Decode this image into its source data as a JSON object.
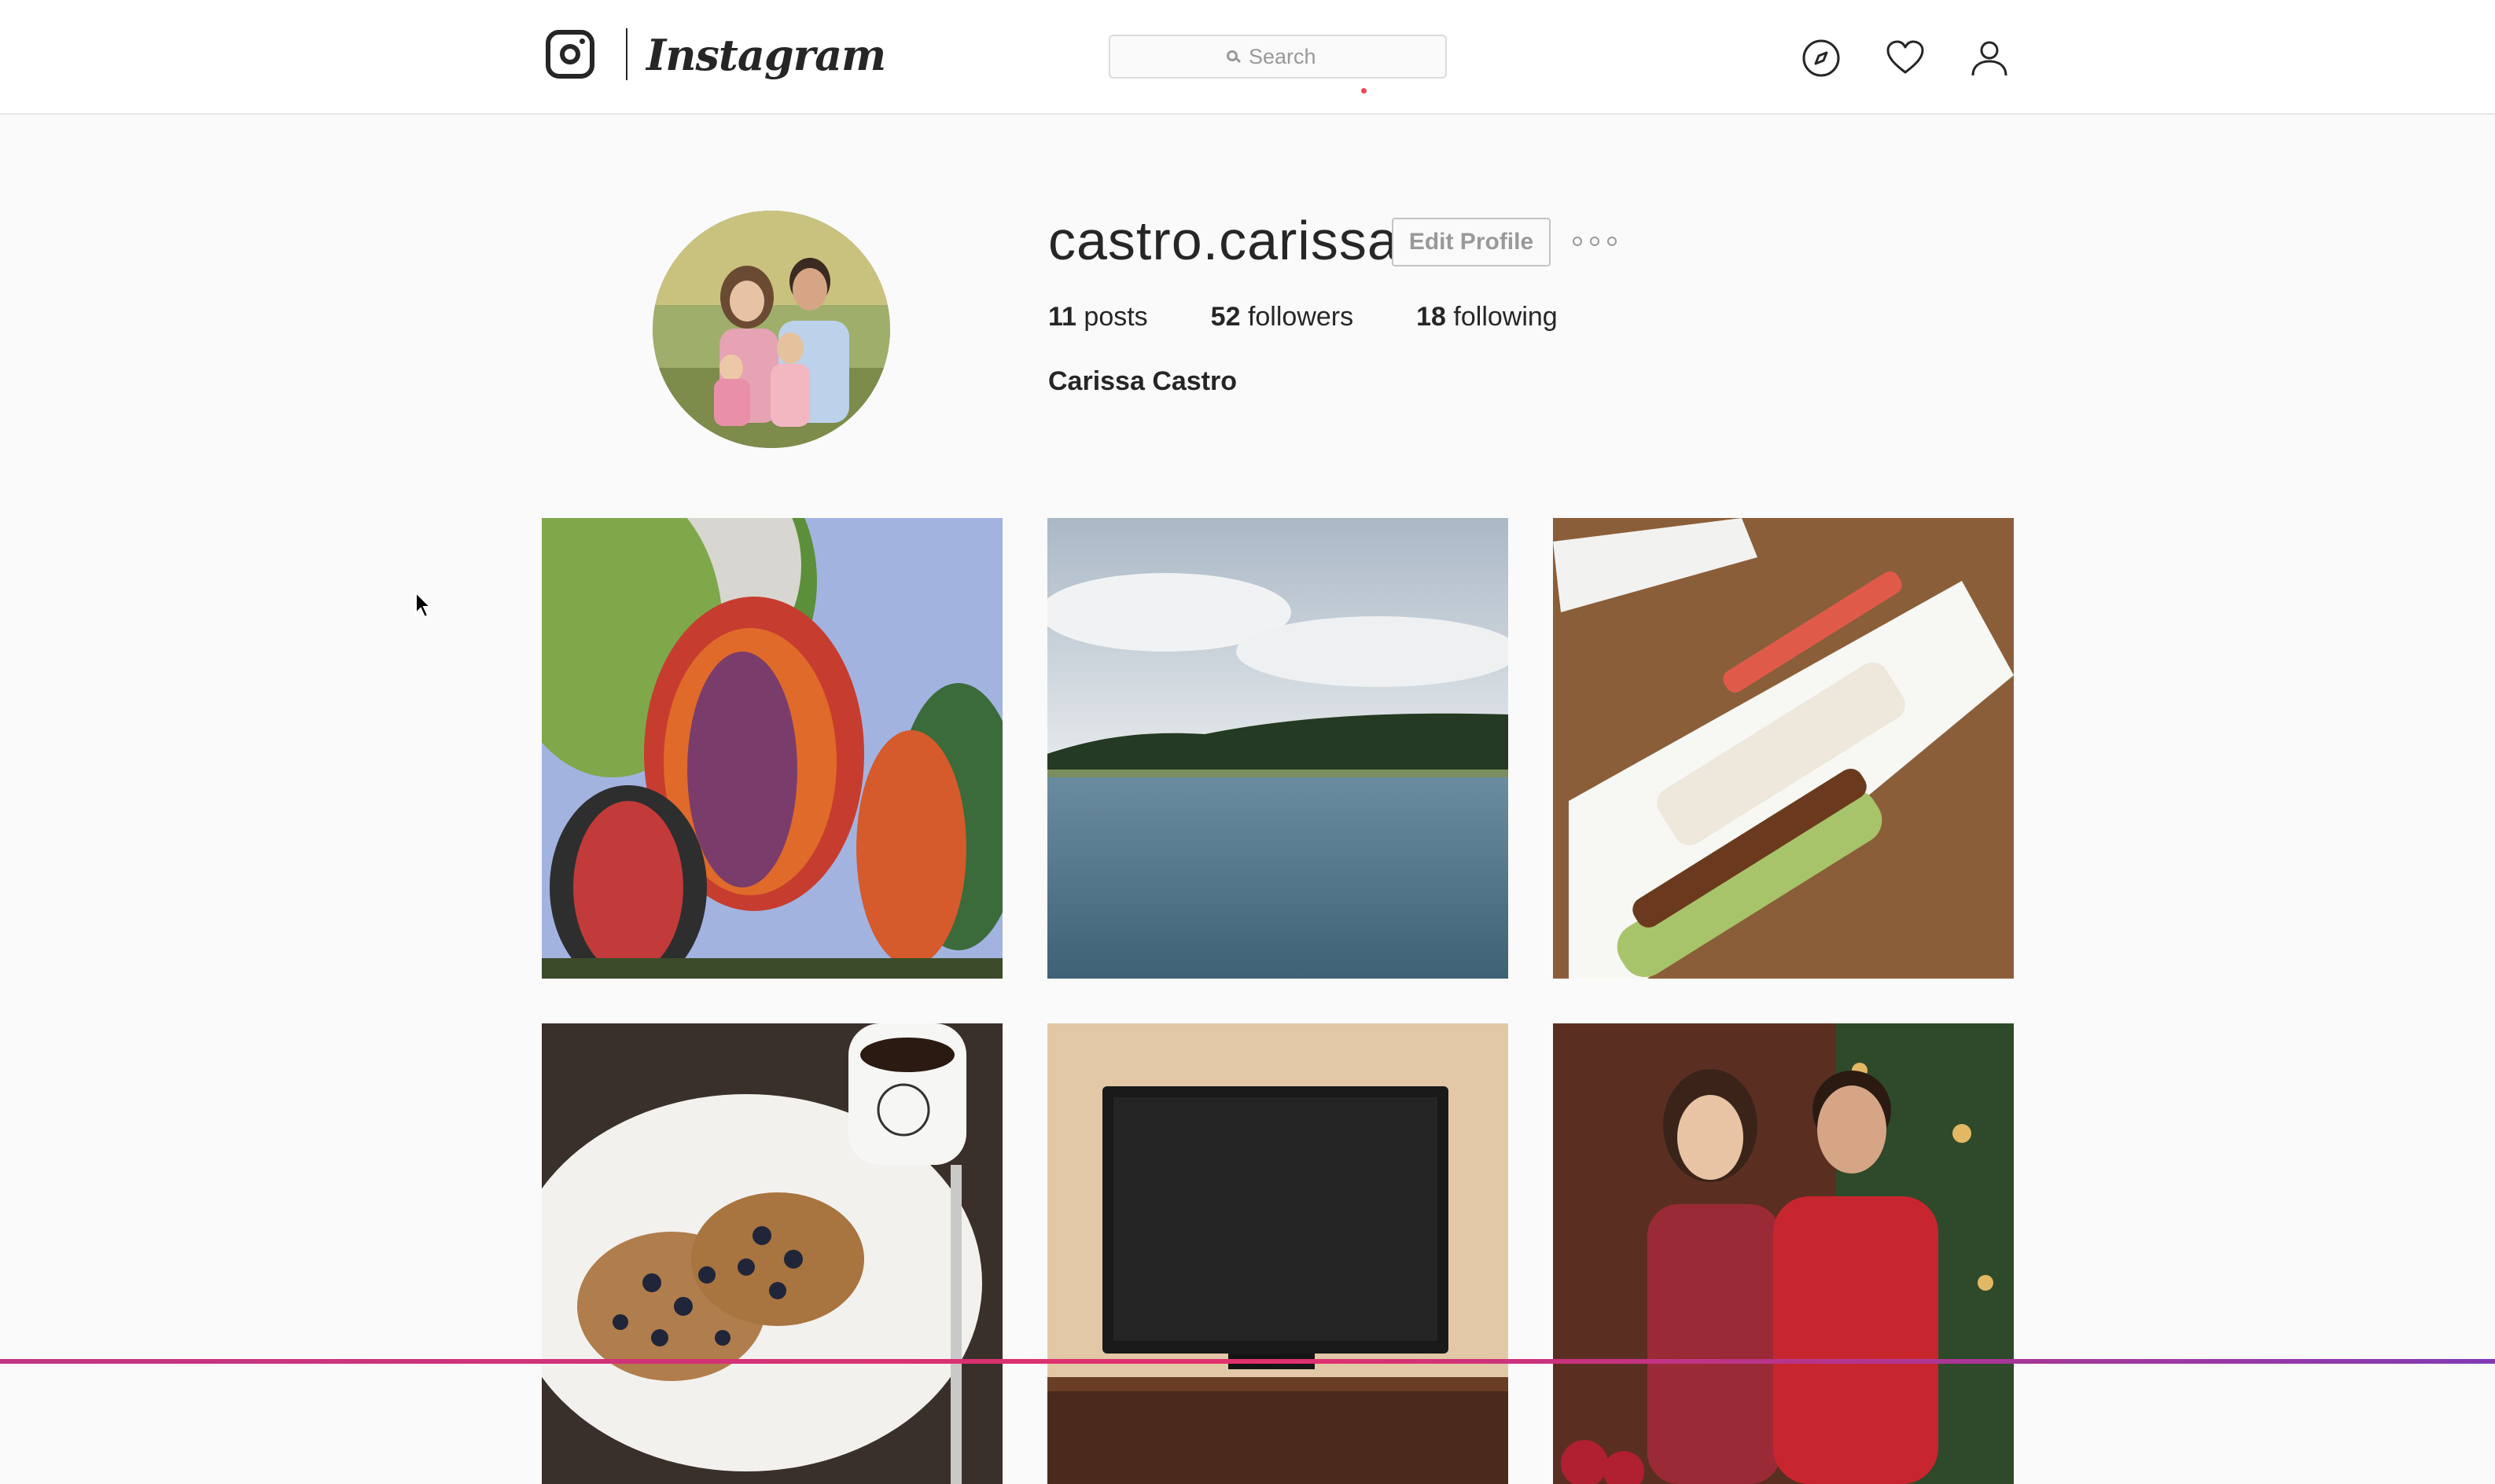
{
  "header": {
    "wordmark": "Instagram",
    "search": {
      "placeholder": "Search"
    },
    "nav": [
      {
        "icon": "compass-icon",
        "label": "Explore"
      },
      {
        "icon": "heart-icon",
        "label": "Activity"
      },
      {
        "icon": "user-icon",
        "label": "Profile"
      }
    ]
  },
  "profile": {
    "username": "castro.carissa",
    "edit_label": "Edit Profile",
    "stats": [
      {
        "count": "11",
        "label": "posts"
      },
      {
        "count": "52",
        "label": "followers"
      },
      {
        "count": "18",
        "label": "following"
      }
    ],
    "full_name": "Carissa Castro"
  },
  "posts": [
    {
      "subject": "hot air balloons"
    },
    {
      "subject": "lake and shoreline"
    },
    {
      "subject": "sushi platter"
    },
    {
      "subject": "waffles with blueberries"
    },
    {
      "subject": "television on cabinet"
    },
    {
      "subject": "couple by christmas tree"
    }
  ],
  "colors": {
    "accent": "#ed4956",
    "text": "#262626",
    "muted": "#999999",
    "background": "#fafafa"
  }
}
